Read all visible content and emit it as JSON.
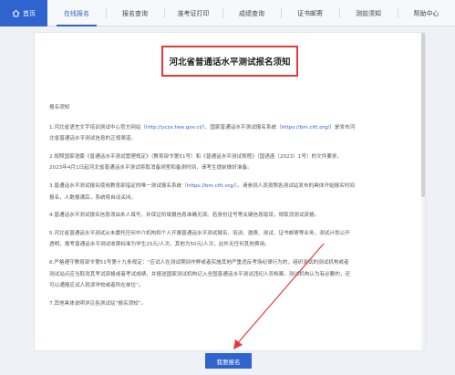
{
  "nav": {
    "home": "首页",
    "items": [
      "在线报名",
      "报名查询",
      "准考证打印",
      "成绩查询",
      "证书邮寄",
      "测前须知",
      "帮助中心"
    ]
  },
  "notice": {
    "title": "河北省普通话水平测试报名须知",
    "heading": "报名须知",
    "p1_a": "1.河北省语言文字培训测试中心官方网站（",
    "p1_link1": "http://yczx.hee.gov.cl/",
    "p1_b": "）、国家普通话水平测试报名系统（",
    "p1_link2": "https://bm.cltt.org/",
    "p1_c": "）是发布河",
    "p1_d": "北省普通话水平测试信息的正规渠道。",
    "p2_a": "2.按照国家语委《普通话水平测试管理规定》（教育部令第51号）和《普通话水平测试规程》（国语函〔2023〕1号）的文件要求，",
    "p2_b": "2023年4月1日起河北省普通话水平测试将取消备测室和备测时间，请考生提前做好准备。",
    "p3_a": "3.普通话水平测试报名使用教育部指定的唯一测试报名系统（",
    "p3_link": "https://bm.cltt.org/",
    "p3_b": "）。请参测人员按照各测试站发布的具体开始报名时间",
    "p3_c": "报名，人数报满后，系统将自动关闭。",
    "p4": "4.普通话水平测试报名信息须由本人填写，并保证所填报信息准确无误。若身份证号等关键信息错误，将取消测试资格。",
    "p5_a": "5.河北省普通话水平测试从未委托任何中介机构和个人开展普通话水平测试报名、培训、邀费、测试、证书邮寄等业务，测试计划公开",
    "p5_b": "透明，报考普通话水平测试收费标准为学生25元/人次，其他为50元/人次，此外无任何其他费用。",
    "p6_a": "6.严格遵守教育部令第51号第十九条规定：“应试人在测试期间作弊或者实施其他严重违反考场纪律行为的，组织测试的测试机构或者",
    "p6_b": "测试站点应当取消其考试资格或者考试成绩，并报送国家测试机构记入全国普通话水平测试违纪人员档案。测试机构认为有必要的，还",
    "p6_c": "可以通报应试人就读学校或者所在单位”。",
    "p7": "7.其他具体说明详见各测试站“报名须知”。"
  },
  "apply_button": "我要报名",
  "colors": {
    "accent": "#2f63ce",
    "highlight": "#e23a3a"
  }
}
